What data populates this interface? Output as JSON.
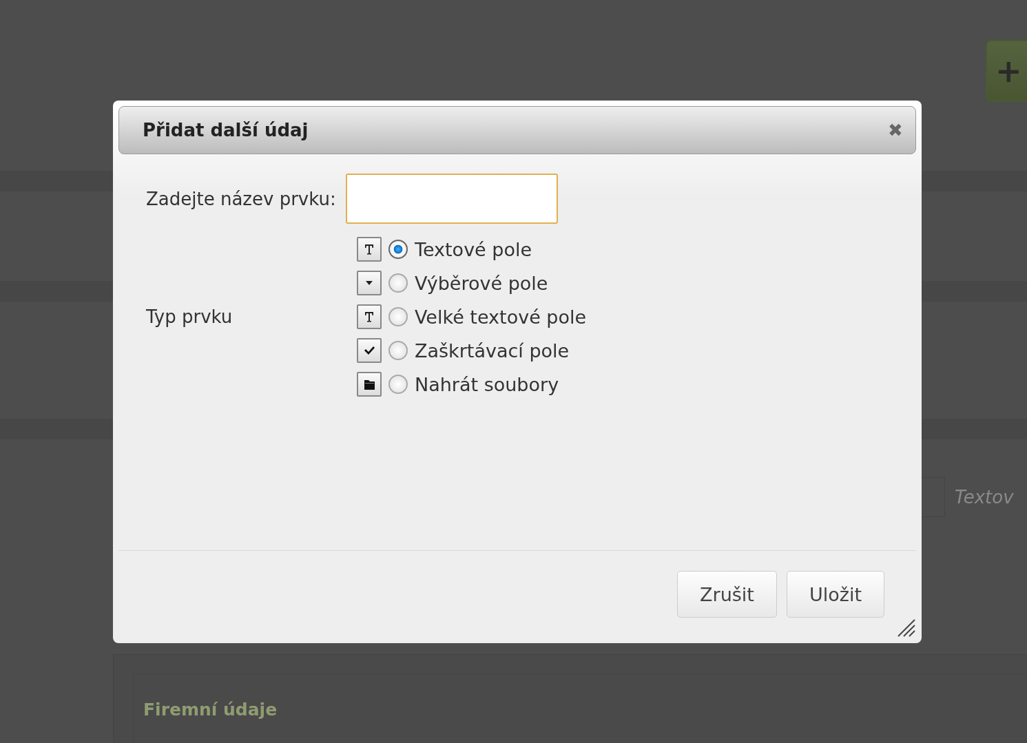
{
  "background": {
    "add_button_label": "+",
    "field_hint": "Textov",
    "section_title": "Firemní údaje"
  },
  "dialog": {
    "title": "Přidat další údaj",
    "close_label": "✖",
    "name_label": "Zadejte název prvku:",
    "type_label": "Typ prvku",
    "options": [
      {
        "label": "Textové pole",
        "kind": "text",
        "selected": true
      },
      {
        "label": "Výběrové pole",
        "kind": "select",
        "selected": false
      },
      {
        "label": "Velké textové pole",
        "kind": "text",
        "selected": false
      },
      {
        "label": "Zaškrtávací pole",
        "kind": "checkbox",
        "selected": false
      },
      {
        "label": "Nahrát soubory",
        "kind": "file",
        "selected": false
      }
    ],
    "buttons": [
      "Zrušit",
      "Uložit"
    ]
  }
}
